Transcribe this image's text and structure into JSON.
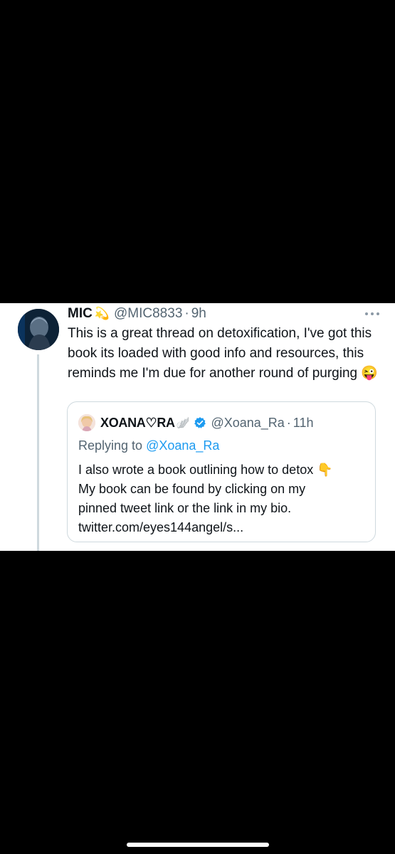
{
  "tweet": {
    "author_name": "MIC",
    "author_emoji": "💫",
    "handle": "@MIC8833",
    "separator": "·",
    "time": "9h",
    "text": "This is a great thread on detoxification, I've got this book its loaded with good info and resources, this reminds me I'm due for another round of purging 😜"
  },
  "quote": {
    "author_name": "XOANA♡RA",
    "author_emoji": "🪽",
    "handle": "@Xoana_Ra",
    "separator": "·",
    "time": "11h",
    "replying_prefix": "Replying to",
    "replying_handle": "@Xoana_Ra",
    "text_lines": [
      "I also wrote a book outlining how to detox 👇",
      "My book can be found by clicking on my",
      "pinned tweet link or the link in my bio.",
      "twitter.com/eyes144angel/s..."
    ]
  },
  "colors": {
    "background": "#000000",
    "card": "#ffffff",
    "text_primary": "#0f1419",
    "text_secondary": "#536471",
    "link": "#1d9bf0",
    "border": "#cfd9de"
  },
  "icons": {
    "more": "more-horizontal-icon",
    "verified": "verified-badge-icon"
  }
}
